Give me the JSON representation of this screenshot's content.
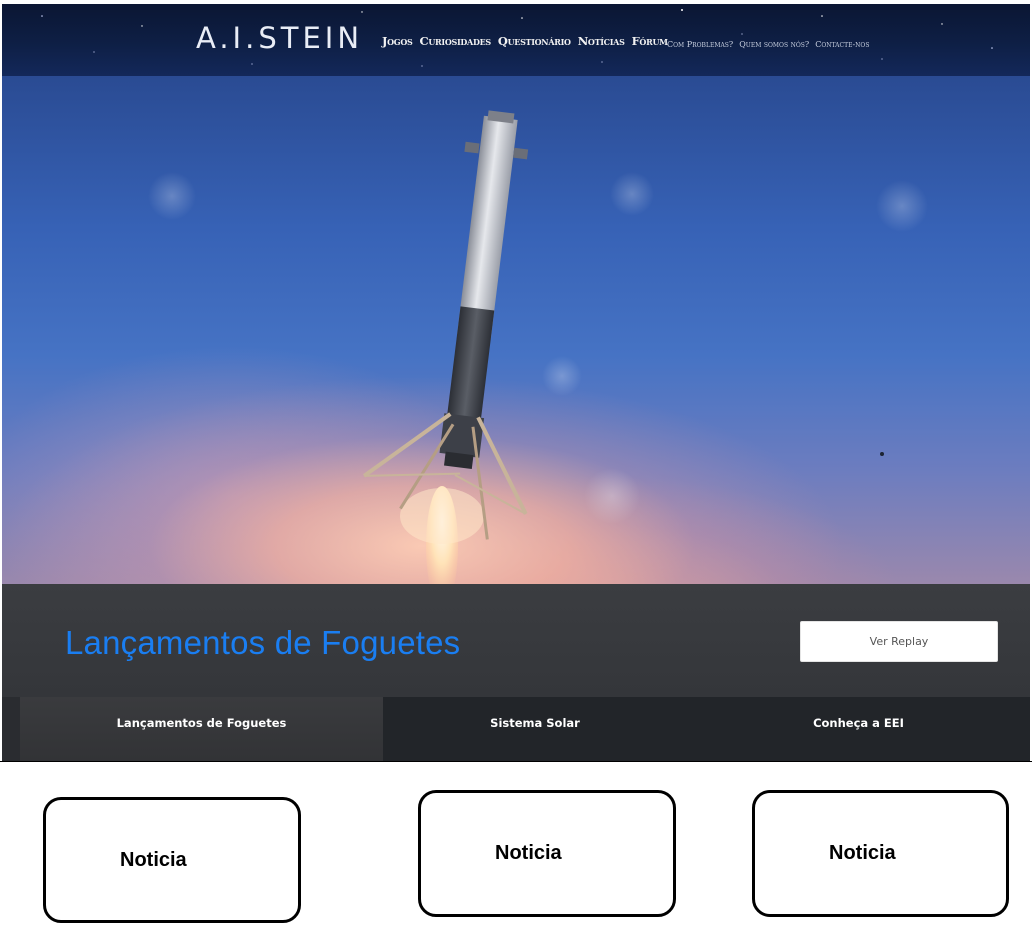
{
  "header": {
    "logo": "A.I.STEIN",
    "nav": [
      "Jogos",
      "Curiosidades",
      "Questionário",
      "Notícias",
      "Fórum"
    ],
    "subnav": [
      "Com Problemas?",
      "Quem somos nós?",
      "Contacte-nos"
    ]
  },
  "hero": {
    "image": "rocket-landing-photo",
    "caption_title": "Lançamentos de Foguetes",
    "replay_button": "Ver Replay"
  },
  "tabs": [
    "Lançamentos de Foguetes",
    "Sistema Solar",
    "Conheça a EEI"
  ],
  "news_cards": [
    "Noticia",
    "Noticia",
    "Noticia"
  ],
  "colors": {
    "accent_blue": "#1a7ef2",
    "nav_background": "#0e1f45",
    "caption_background": "#36383c",
    "tab_background": "#222529"
  }
}
